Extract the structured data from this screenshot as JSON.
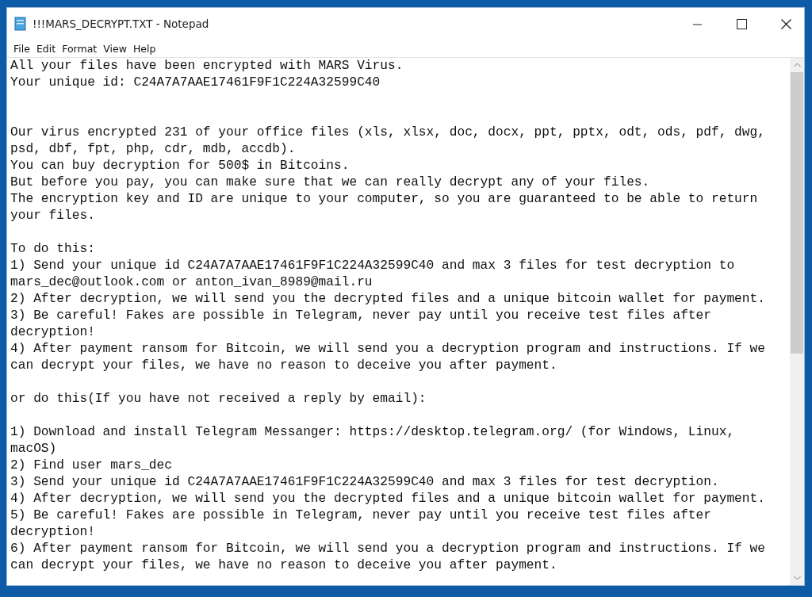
{
  "window": {
    "title": "!!!MARS_DECRYPT.TXT - Notepad"
  },
  "menu": [
    "File",
    "Edit",
    "Format",
    "View",
    "Help"
  ],
  "document": {
    "lines": [
      {
        "kind": "text",
        "text": "All your files have been encrypted with MARS Virus."
      },
      {
        "kind": "text",
        "text": "Your unique id: C24A7A7AAE17461F9F1C224A32599C40"
      },
      {
        "kind": "blank"
      },
      {
        "kind": "blank"
      },
      {
        "kind": "text",
        "text": "Our virus encrypted 231 of your office files (xls, xlsx, doc, docx, ppt, pptx, odt, ods, pdf, dwg, psd, dbf, fpt, php, cdr, mdb, accdb)."
      },
      {
        "kind": "text",
        "text": "You can buy decryption for 500$ in Bitcoins."
      },
      {
        "kind": "text",
        "text": "But before you pay, you can make sure that we can really decrypt any of your files."
      },
      {
        "kind": "text",
        "text": "The encryption key and ID are unique to your computer, so you are guaranteed to be able to return your files."
      },
      {
        "kind": "blank"
      },
      {
        "kind": "text",
        "text": "To do this:"
      },
      {
        "kind": "text",
        "text": "1) Send your unique id C24A7A7AAE17461F9F1C224A32599C40 and max 3 files for test decryption to mars_dec@outlook.com or anton_ivan_8989@mail.ru"
      },
      {
        "kind": "text",
        "text": "2) After decryption, we will send you the decrypted files and a unique bitcoin wallet for payment."
      },
      {
        "kind": "text",
        "text": "3) Be careful! Fakes are possible in Telegram, never pay until you receive test files after decryption!"
      },
      {
        "kind": "text",
        "text": "4) After payment ransom for Bitcoin, we will send you a decryption program and instructions. If we can decrypt your files, we have no reason to deceive you after payment."
      },
      {
        "kind": "blank"
      },
      {
        "kind": "text",
        "text": "or do this(If you have not received a reply by email):"
      },
      {
        "kind": "blank"
      },
      {
        "kind": "text",
        "text": "1) Download and install Telegram Messanger: https://desktop.telegram.org/ (for Windows, Linux, macOS)"
      },
      {
        "kind": "text",
        "text": "2) Find user mars_dec"
      },
      {
        "kind": "text",
        "text": "3) Send your unique id C24A7A7AAE17461F9F1C224A32599C40 and max 3 files for test decryption."
      },
      {
        "kind": "text",
        "text": "4) After decryption, we will send you the decrypted files and a unique bitcoin wallet for payment."
      },
      {
        "kind": "text",
        "text": "5) Be careful! Fakes are possible in Telegram, never pay until you receive test files after decryption!"
      },
      {
        "kind": "text",
        "text": "6) After payment ransom for Bitcoin, we will send you a decryption program and instructions. If we can decrypt your files, we have no reason to deceive you after payment."
      }
    ]
  }
}
